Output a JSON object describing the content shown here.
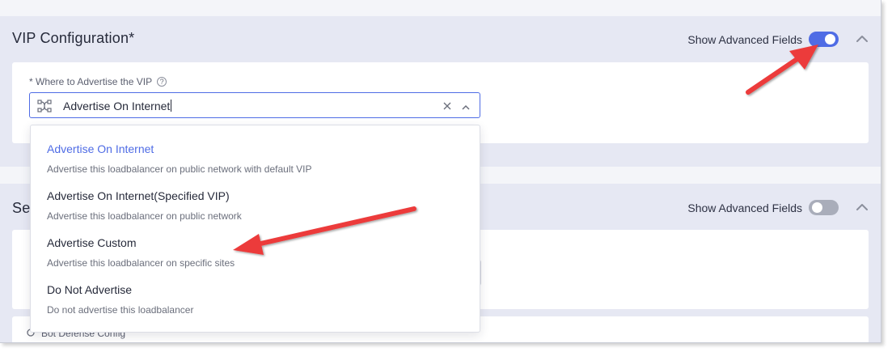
{
  "vip_section": {
    "title": "VIP Configuration",
    "required_mark": "*",
    "advanced_label": "Show Advanced Fields",
    "advanced_on": true,
    "field": {
      "label": "* Where to Advertise the VIP",
      "help_icon": "?",
      "value": "Advertise On Internet"
    }
  },
  "dropdown": {
    "options": [
      {
        "title": "Advertise On Internet",
        "desc": "Advertise this loadbalancer on public network with default VIP",
        "selected": true
      },
      {
        "title": "Advertise On Internet(Specified VIP)",
        "desc": "Advertise this loadbalancer on public network",
        "selected": false
      },
      {
        "title": "Advertise Custom",
        "desc": "Advertise this loadbalancer on specific sites",
        "selected": false
      },
      {
        "title": "Do Not Advertise",
        "desc": "Do not advertise this loadbalancer",
        "selected": false
      }
    ]
  },
  "second_section": {
    "title_partial": "Se",
    "advanced_label": "Show Advanced Fields",
    "advanced_on": false
  },
  "bottom_field": {
    "label": "Bot Defense Config"
  },
  "colors": {
    "accent": "#4f6ce5",
    "annotation_arrow": "#ec3a3a",
    "section_bg": "#e6e8f3"
  }
}
